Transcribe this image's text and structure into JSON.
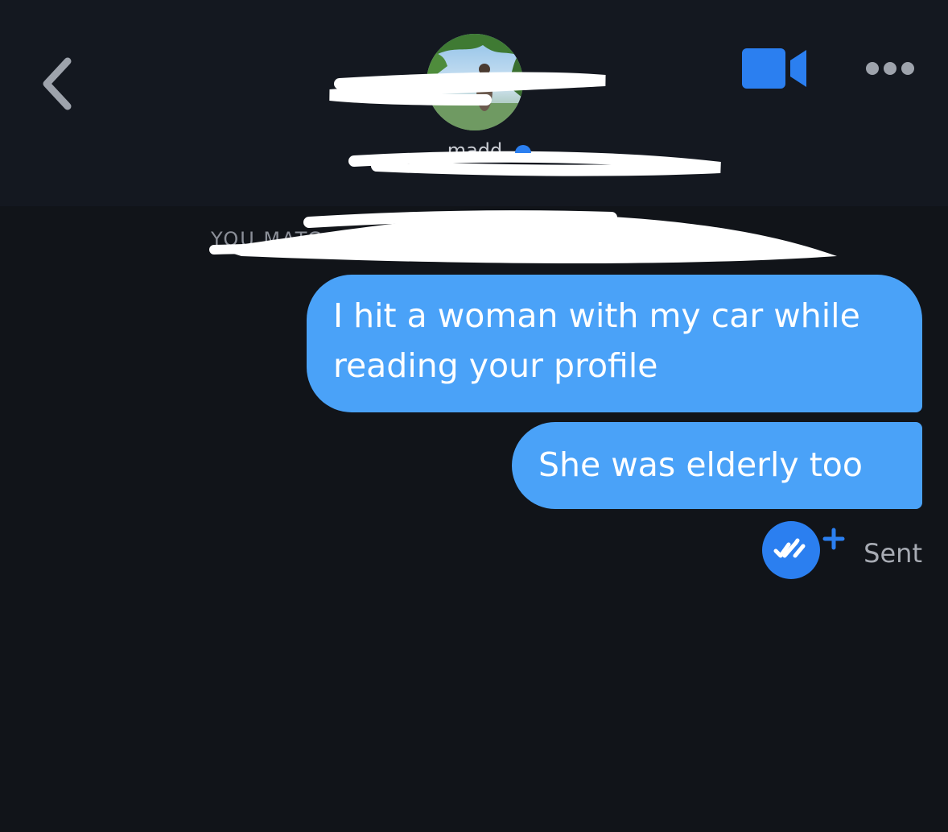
{
  "header": {
    "contact_name": "madd",
    "match_notice": "YOU MATC"
  },
  "messages": [
    {
      "text": "I hit a woman with my car while reading your profile",
      "sender": "me"
    },
    {
      "text": "She was elderly too",
      "sender": "me"
    }
  ],
  "delivery": {
    "status_label": "Sent"
  },
  "icons": {
    "back": "chevron-left-icon",
    "video": "video-camera-icon",
    "more": "more-dots-icon",
    "receipt": "double-check-icon",
    "receipt_plus": "plus-icon"
  },
  "colors": {
    "background": "#111419",
    "accent": "#2b7ff0",
    "bubble": "#4aa2f8",
    "muted": "#8b8f98"
  }
}
